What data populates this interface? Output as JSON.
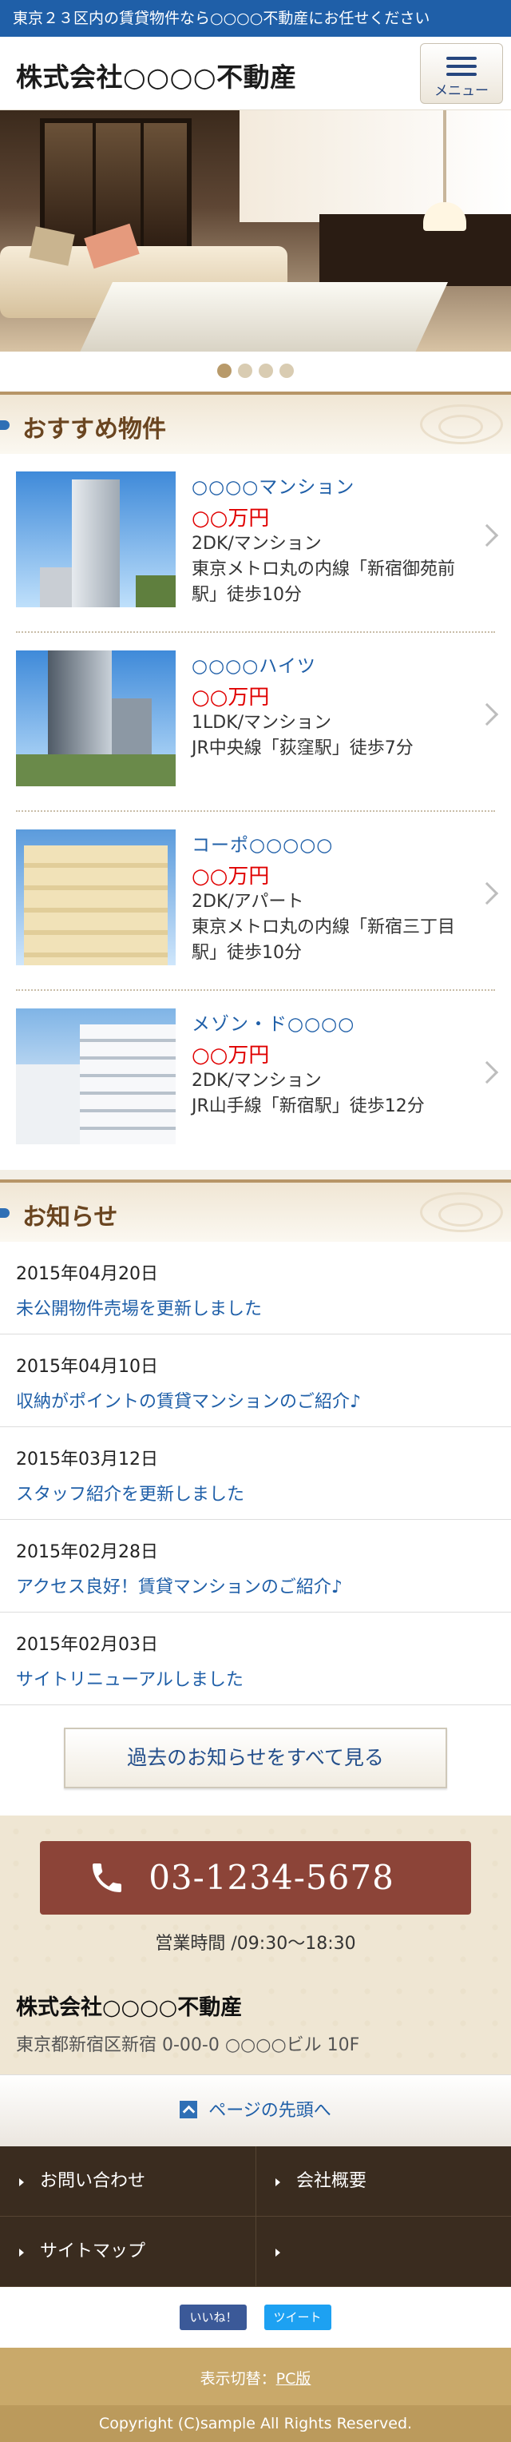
{
  "topbar": {
    "text": "東京２３区内の賃貸物件なら○○○○不動産にお任せください"
  },
  "header": {
    "title": "株式会社○○○○不動産",
    "menu_label": "メニュー"
  },
  "slider": {
    "dots": 4,
    "active_index": 0
  },
  "featured": {
    "title": "おすすめ物件",
    "items": [
      {
        "name": "○○○○マンション",
        "price": "○○万円",
        "type": "2DK/マンション",
        "access": "東京メトロ丸の内線「新宿御苑前駅」徒歩10分"
      },
      {
        "name": "○○○○ハイツ",
        "price": "○○万円",
        "type": "1LDK/マンション",
        "access": "JR中央線「荻窪駅」徒歩7分"
      },
      {
        "name": "コーポ○○○○○",
        "price": "○○万円",
        "type": "2DK/アパート",
        "access": "東京メトロ丸の内線「新宿三丁目駅」徒歩10分"
      },
      {
        "name": "メゾン・ド○○○○",
        "price": "○○万円",
        "type": "2DK/マンション",
        "access": "JR山手線「新宿駅」徒歩12分"
      }
    ]
  },
  "news": {
    "title": "お知らせ",
    "items": [
      {
        "date": "2015年04月20日",
        "text": "未公開物件売場を更新しました"
      },
      {
        "date": "2015年04月10日",
        "text": "収納がポイントの賃貸マンションのご紹介♪"
      },
      {
        "date": "2015年03月12日",
        "text": "スタッフ紹介を更新しました"
      },
      {
        "date": "2015年02月28日",
        "text": "アクセス良好！賃貸マンションのご紹介♪"
      },
      {
        "date": "2015年02月03日",
        "text": "サイトリニューアルしました"
      }
    ],
    "all_button": "過去のお知らせをすべて見る"
  },
  "contact": {
    "phone": "03-1234-5678",
    "hours": "営業時間 /09:30〜18:30",
    "company": "株式会社○○○○不動産",
    "address": "東京都新宿区新宿 0-00-0 ○○○○ビル 10F"
  },
  "pagetop": {
    "label": "ページの先頭へ"
  },
  "footer_nav": {
    "contact": "お問い合わせ",
    "about": "会社概要",
    "sitemap": "サイトマップ"
  },
  "social": {
    "like": "いいね！",
    "tweet": "ツイート"
  },
  "footer": {
    "switch_label": "表示切替：",
    "switch_link": "PC版",
    "copyright": "Copyright (C)sample All Rights Reserved."
  },
  "colors": {
    "brand_blue": "#1f5fa8",
    "price_red": "#e00000",
    "tel_button": "#8c4438",
    "footer_gold": "#c9a96a"
  }
}
